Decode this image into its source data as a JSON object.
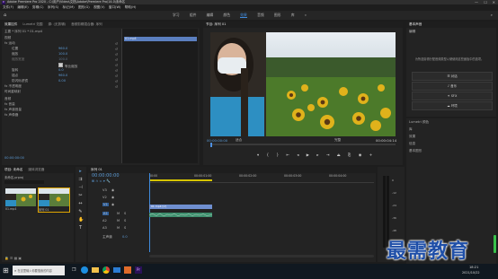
{
  "app": {
    "title": "Adobe Premiere Pro 2020 - C:\\用户\\Video\\文档\\Adobe\\Premiere Pro\\14.0\\未命名",
    "menu": [
      "文件(F)",
      "编辑(E)",
      "剪辑(C)",
      "序列(S)",
      "标记(M)",
      "图形(G)",
      "视图(V)",
      "窗口(W)",
      "帮助(H)"
    ],
    "workspaces": [
      "学习",
      "组件",
      "编辑",
      "颜色",
      "效果",
      "音频",
      "图形",
      "库"
    ],
    "active_workspace": "效果",
    "window_controls": [
      "minimize",
      "maximize",
      "close"
    ]
  },
  "effect_controls": {
    "tabs": [
      "效果控件",
      "Lumetri 范围",
      "源: (无剪辑)",
      "音频剪辑混合器: 序列"
    ],
    "header": "主要 * 序列 01 * 01.mp4",
    "clip_label": "01.mp4",
    "section_video": "视频",
    "rows": [
      {
        "label": "fx 运动",
        "value": ""
      },
      {
        "label": "位置",
        "value": "960.0"
      },
      {
        "label": "缩放",
        "value": "100.0"
      },
      {
        "label": "缩放宽度",
        "value": "100.0"
      },
      {
        "label": "等比缩放",
        "value": ""
      },
      {
        "label": "旋转",
        "value": "0.0"
      },
      {
        "label": "锚点",
        "value": "960.0"
      },
      {
        "label": "防闪烁滤镜",
        "value": "0.00"
      },
      {
        "label": "fx 不透明度",
        "value": ""
      },
      {
        "label": "时间重映射",
        "value": ""
      }
    ],
    "section_audio": "音频",
    "audio_rows": [
      "fx 音量",
      "fx 声道音量",
      "fx 声像器"
    ],
    "timecode": "00:00:00:00"
  },
  "program_monitor": {
    "title": "节目: 序列 01",
    "timecode_left": "00:00:00:00",
    "fit_label": "适合",
    "quality": "完整",
    "timecode_right": "00:00:04:14"
  },
  "project_panel": {
    "tabs": [
      "项目: 未命名",
      "媒体浏览器"
    ],
    "project_file": "未命名.prproj",
    "items": [
      {
        "name": "01.mp4",
        "duration": "4:14"
      },
      {
        "name": "序列 01",
        "duration": "4:14"
      }
    ]
  },
  "timeline": {
    "tab": "序列 01",
    "timecode": "00:00:00:00",
    "ruler": [
      "00:00",
      "00:00:01:00",
      "00:00:02:00",
      "00:00:03:00",
      "00:00:04:00"
    ],
    "video_tracks": [
      "V3",
      "V2",
      "V1"
    ],
    "audio_tracks": [
      "A1",
      "A2",
      "A3"
    ],
    "master": "主声道",
    "master_value": "0.0",
    "clip_video": "01.mp4 [V]",
    "clip_audio": ""
  },
  "essential_panel": {
    "title": "基本声音",
    "subtitle": "编辑",
    "description": "为所选剪辑分配音频类型以便使用这些面板中的选项。",
    "buttons": [
      "对话",
      "音乐",
      "SFX",
      "环境"
    ],
    "tabs": [
      "Lumetri 颜色",
      "库",
      "效果",
      "信息"
    ],
    "extra": [
      "基本图形"
    ]
  },
  "audio_meter": {
    "labels": [
      "0",
      "-12",
      "-24",
      "-36",
      "-48",
      "dB"
    ]
  },
  "taskbar": {
    "search_placeholder": "在这里输入你要搜索的内容",
    "time": "18:21",
    "date": "2021/10/22"
  },
  "watermark": "最需教育"
}
